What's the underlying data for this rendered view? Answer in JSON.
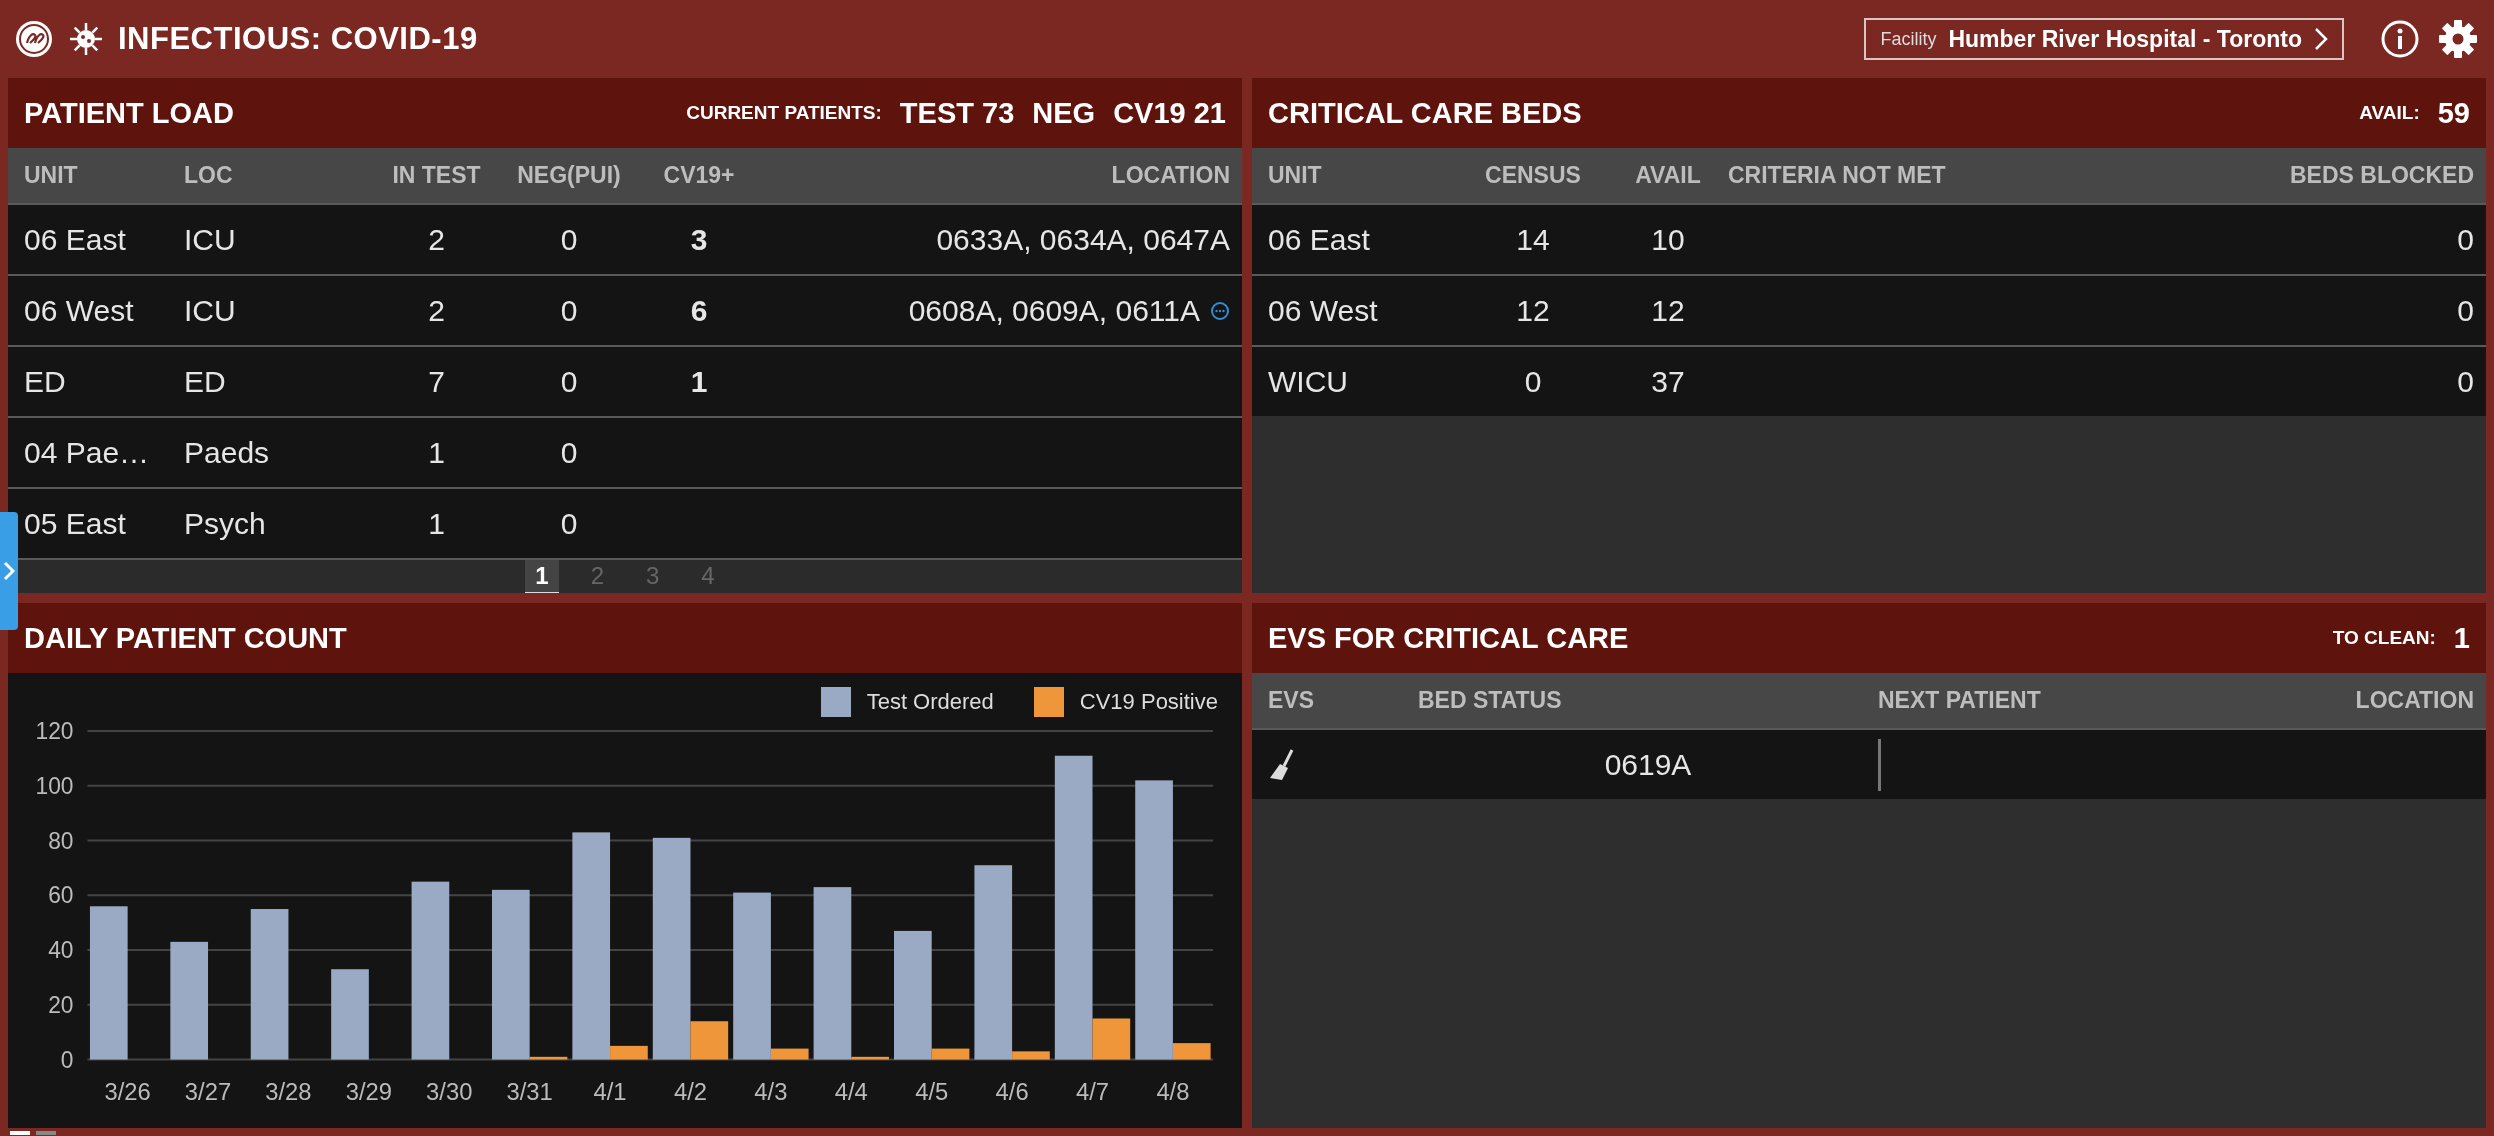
{
  "app": {
    "title": "INFECTIOUS: COVID-19",
    "facility_label": "Facility",
    "facility": "Humber River Hospital - Toronto"
  },
  "patient_load": {
    "title": "PATIENT LOAD",
    "summary_label": "CURRENT PATIENTS:",
    "summary": [
      "TEST 73",
      "NEG",
      "CV19 21"
    ],
    "columns": [
      "UNIT",
      "LOC",
      "IN TEST",
      "NEG(PUI)",
      "CV19+",
      "LOCATION"
    ],
    "rows": [
      {
        "unit": "06 East",
        "loc": "ICU",
        "in_test": "2",
        "neg": "0",
        "cv19": "3",
        "location": "0633A, 0634A, 0647A",
        "more": false
      },
      {
        "unit": "06 West",
        "loc": "ICU",
        "in_test": "2",
        "neg": "0",
        "cv19": "6",
        "location": "0608A, 0609A, 0611A",
        "more": true
      },
      {
        "unit": "ED",
        "loc": "ED",
        "in_test": "7",
        "neg": "0",
        "cv19": "1",
        "location": "",
        "more": false
      },
      {
        "unit": "04 Pae…",
        "loc": "Paeds",
        "in_test": "1",
        "neg": "0",
        "cv19": "",
        "location": "",
        "more": false
      },
      {
        "unit": "05 East",
        "loc": "Psych",
        "in_test": "1",
        "neg": "0",
        "cv19": "",
        "location": "",
        "more": false
      }
    ],
    "pages": [
      {
        "label": "1",
        "selected": true
      },
      {
        "label": "2",
        "selected": false
      },
      {
        "label": "3",
        "selected": false
      },
      {
        "label": "4",
        "selected": false
      }
    ]
  },
  "critical_care": {
    "title": "CRITICAL CARE BEDS",
    "summary_label": "AVAIL:",
    "summary": "59",
    "columns": [
      "UNIT",
      "CENSUS",
      "AVAIL",
      "CRITERIA NOT MET",
      "BEDS BLOCKED"
    ],
    "rows": [
      {
        "unit": "06 East",
        "census": "14",
        "avail": "10",
        "criteria": "",
        "blocked": "0"
      },
      {
        "unit": "06 West",
        "census": "12",
        "avail": "12",
        "criteria": "",
        "blocked": "0"
      },
      {
        "unit": "WICU",
        "census": "0",
        "avail": "37",
        "criteria": "",
        "blocked": "0"
      }
    ]
  },
  "daily_count": {
    "title": "DAILY PATIENT COUNT",
    "chart_data": {
      "type": "bar",
      "categories": [
        "3/26",
        "3/27",
        "3/28",
        "3/29",
        "3/30",
        "3/31",
        "4/1",
        "4/2",
        "4/3",
        "4/4",
        "4/5",
        "4/6",
        "4/7",
        "4/8"
      ],
      "ylim": [
        0,
        120
      ],
      "grid": true,
      "yticks": [
        0,
        20,
        40,
        60,
        80,
        100,
        120
      ],
      "series": [
        {
          "name": "Test Ordered",
          "color": "#9aaac4",
          "values": [
            56,
            43,
            55,
            33,
            65,
            62,
            83,
            81,
            61,
            63,
            47,
            71,
            111,
            102
          ]
        },
        {
          "name": "CV19 Positive",
          "color": "#f0963a",
          "values": [
            0,
            0,
            0,
            0,
            0,
            1,
            5,
            14,
            4,
            1,
            4,
            3,
            15,
            6
          ]
        }
      ]
    }
  },
  "evs": {
    "title": "EVS FOR CRITICAL CARE",
    "summary_label": "TO CLEAN:",
    "summary": "1",
    "columns": [
      "EVS",
      "BED STATUS",
      "NEXT PATIENT",
      "LOCATION"
    ],
    "rows": [
      {
        "needs_cleaning": true,
        "bed": "0619A",
        "next_patient": "",
        "location": ""
      }
    ]
  },
  "carousel": [
    {
      "selected": true
    },
    {
      "selected": false
    }
  ]
}
